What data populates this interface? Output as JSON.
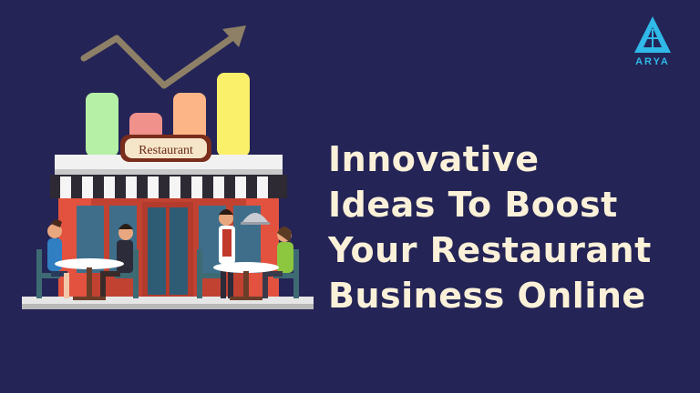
{
  "headline": {
    "line1": "Innovative",
    "line2": "Ideas To Boost",
    "line3": "Your Restaurant",
    "line4": "Business Online"
  },
  "sign": {
    "text": "Restaurant"
  },
  "logo": {
    "text": "ARYA",
    "icon": "triangle-logo-icon"
  },
  "colors": {
    "background": "#242456",
    "headline": "#FBF1D9",
    "logo": "#2FB8E8",
    "trend_arrow": "#8E8067",
    "bars": [
      "#B5F0A6",
      "#F0918C",
      "#FBB587",
      "#FBF06A"
    ],
    "awning_red": "#D5503A",
    "building_brick": "#E2523E"
  }
}
